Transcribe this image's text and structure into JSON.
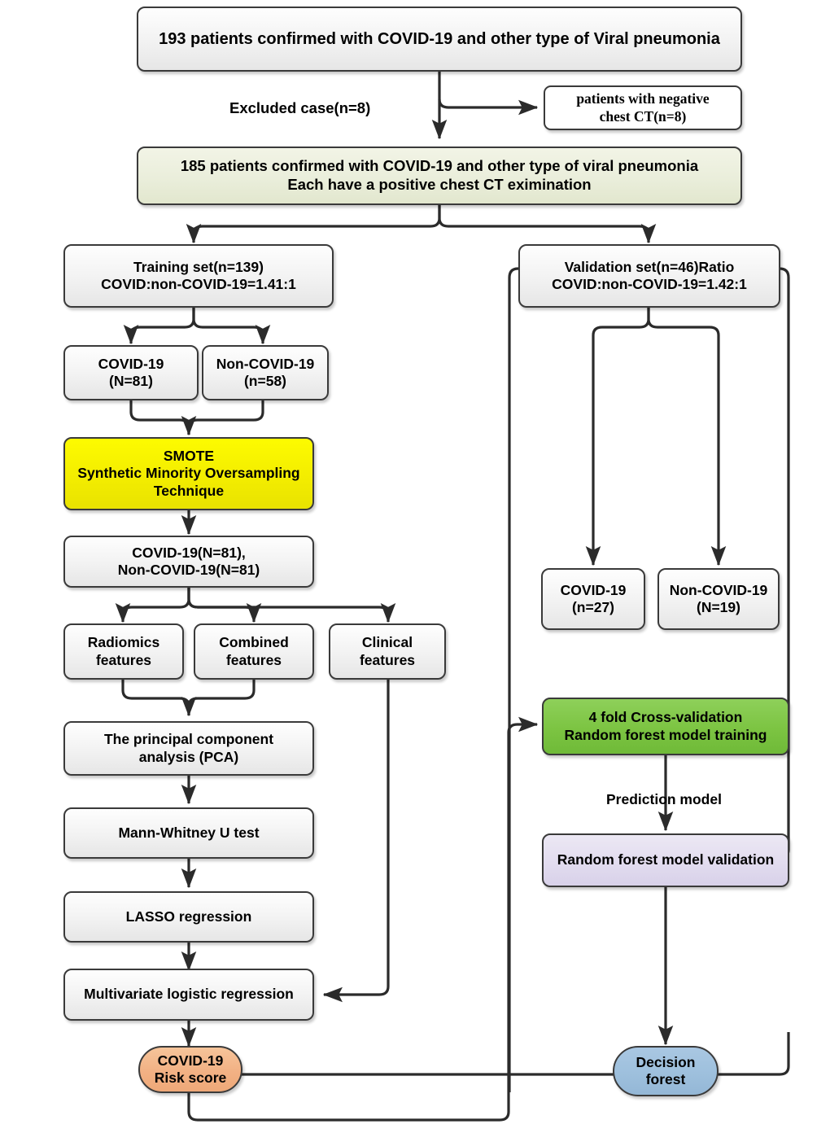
{
  "diagram": {
    "title": "COVID-19 radiomics study flowchart",
    "colors": {
      "yellow": "#F5EE00",
      "green": "#7CC442",
      "purple": "#E2DCEF",
      "orange": "#F2B184",
      "blue": "#9EC0DD",
      "olive": "#EAEEDB",
      "grey": "#F1F1F1",
      "stroke": "#3A3A3A"
    },
    "nodes": [
      {
        "id": "cohort",
        "text": "193 patients confirmed with COVID-19 and other type of Viral pneumonia"
      },
      {
        "id": "excluded",
        "line1": "patients with negative",
        "line2": "chest CT(n=8)"
      },
      {
        "id": "included",
        "line1": "185 patients confirmed with COVID-19 and other type of viral pneumonia",
        "line2": "Each have a positive chest CT eximination"
      },
      {
        "id": "training",
        "line1": "Training set(n=139)",
        "line2": "COVID:non-COVID-19=1.41:1"
      },
      {
        "id": "validation",
        "line1": "Validation set(n=46)Ratio",
        "line2": "COVID:non-COVID-19=1.42:1"
      },
      {
        "id": "train_covid",
        "line1": "COVID-19",
        "line2": "(N=81)"
      },
      {
        "id": "train_noncov",
        "line1": "Non-COVID-19",
        "line2": "(n=58)"
      },
      {
        "id": "smote",
        "line1": "SMOTE",
        "line2": "Synthetic Minority Oversampling",
        "line3": "Technique"
      },
      {
        "id": "balanced",
        "line1": "COVID-19(N=81),",
        "line2": "Non-COVID-19(N=81)"
      },
      {
        "id": "radiomics",
        "line1": "Radiomics",
        "line2": "features"
      },
      {
        "id": "combined",
        "line1": "Combined",
        "line2": "features"
      },
      {
        "id": "clinical",
        "line1": "Clinical",
        "line2": "features"
      },
      {
        "id": "pca",
        "line1": "The principal component",
        "line2": "analysis (PCA)"
      },
      {
        "id": "mannwhitney",
        "text": "Mann-Whitney U test"
      },
      {
        "id": "lasso",
        "text": "LASSO regression"
      },
      {
        "id": "multivariate",
        "text": "Multivariate logistic regression"
      },
      {
        "id": "riskscore",
        "line1": "COVID-19",
        "line2": "Risk score"
      },
      {
        "id": "val_covid",
        "line1": "COVID-19",
        "line2": "(n=27)"
      },
      {
        "id": "val_noncov",
        "line1": "Non-COVID-19",
        "line2": "(N=19)"
      },
      {
        "id": "crossval",
        "line1": "4 fold Cross-validation",
        "line2": "Random forest model training"
      },
      {
        "id": "rfvalidation",
        "text": "Random forest model validation"
      },
      {
        "id": "decisionforest",
        "line1": "Decision",
        "line2": "forest"
      }
    ],
    "edge_labels": {
      "excluded_case": "Excluded case(n=8)",
      "prediction_model": "Prediction model"
    }
  }
}
